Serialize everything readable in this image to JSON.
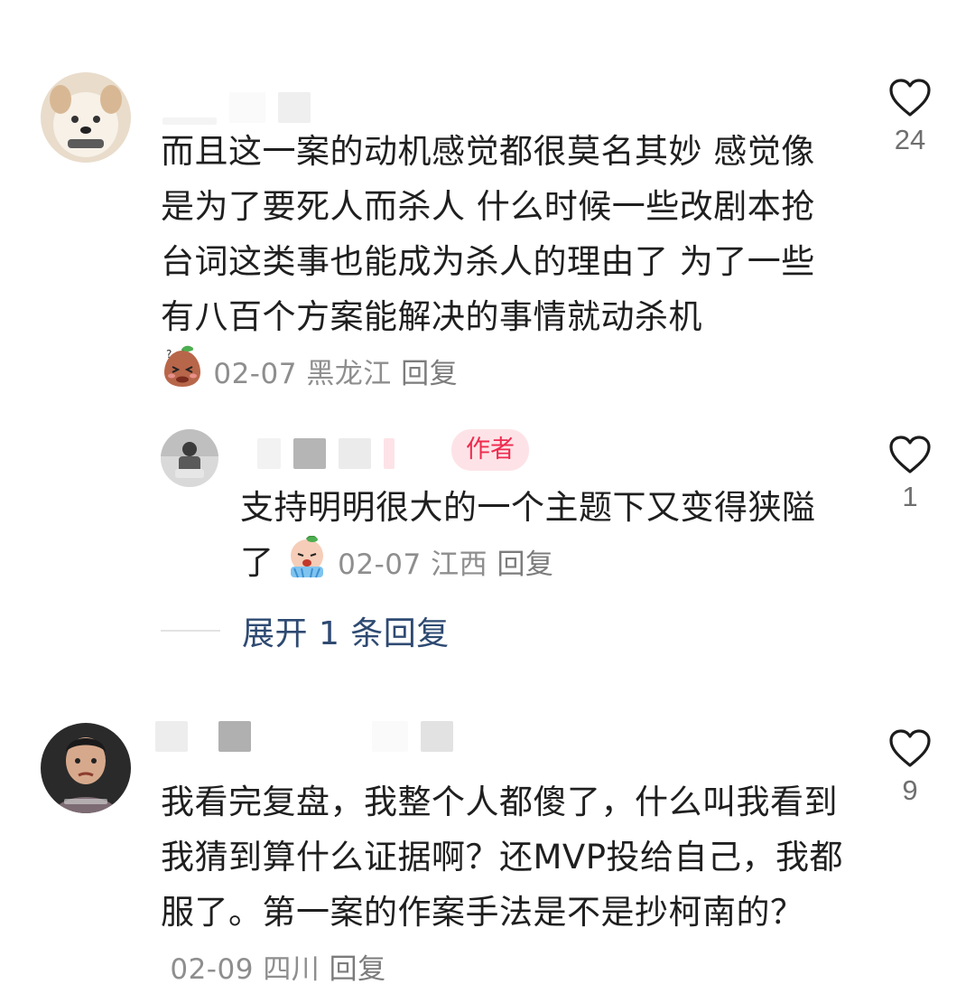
{
  "comments": [
    {
      "text": "而且这一案的动机感觉都很莫名其妙 感觉像是为了要死人而杀人 什么时候一些改剧本抢台词这类事也能成为杀人的理由了 为了一些有八百个方案能解决的事情就动杀机",
      "date": "02-07",
      "location": "黑龙江",
      "reply_label": "回复",
      "likes": "24",
      "emoji_icon": "shy-bean-emoji"
    },
    {
      "author_badge": "作者",
      "text": "支持明明很大的一个主题下又变得狭隘了",
      "date": "02-07",
      "location": "江西",
      "reply_label": "回复",
      "likes": "1",
      "emoji_icon": "crying-baby-emoji"
    },
    {
      "text": "我看完复盘，我整个人都傻了，什么叫我看到我猜到算什么证据啊？还MVP投给自己，我都服了。第一案的作案手法是不是抄柯南的？",
      "date": "02-09",
      "location": "四川",
      "reply_label": "回复",
      "likes": "9"
    }
  ],
  "expand_replies": "展开 1 条回复",
  "colors": {
    "like_outline": "#1c1c1c",
    "author_badge_bg": "#fde3e7",
    "author_badge_text": "#ee2a4f",
    "expand_link": "#2e4a72",
    "meta_gray": "#8e8e8e"
  }
}
